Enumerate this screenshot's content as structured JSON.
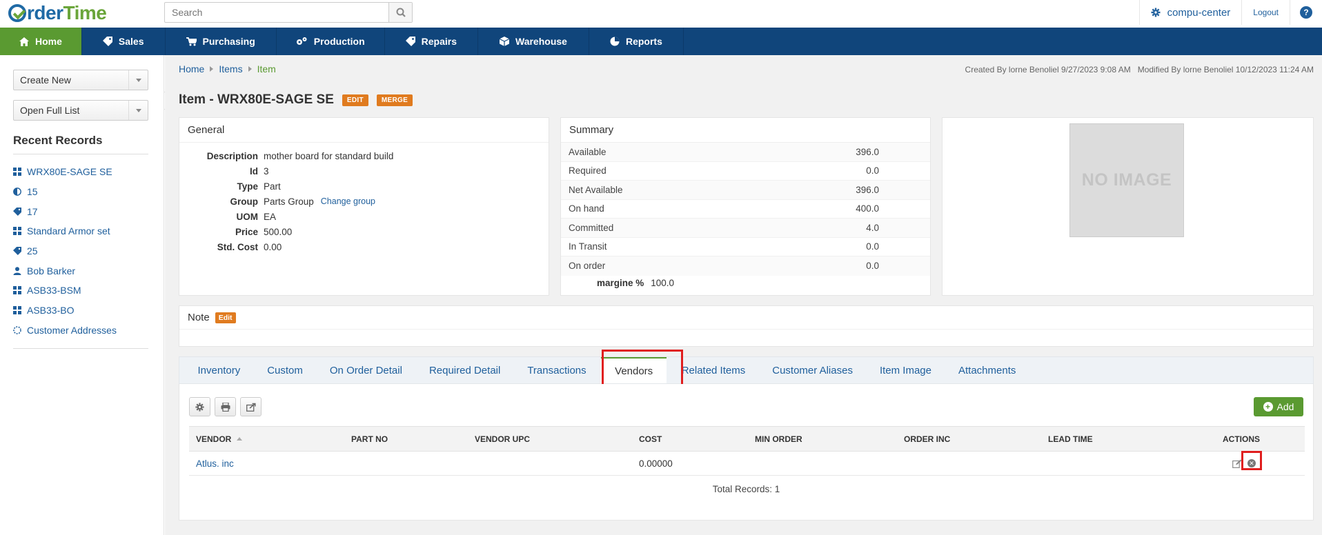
{
  "app": {
    "logo_text_1": "rder",
    "logo_text_2": "Time",
    "search_placeholder": "Search",
    "company": "compu-center",
    "logout": "Logout",
    "help": "?"
  },
  "nav": {
    "items": [
      {
        "label": "Home",
        "icon": "home-icon",
        "active": true
      },
      {
        "label": "Sales",
        "icon": "tag-icon"
      },
      {
        "label": "Purchasing",
        "icon": "cart-icon"
      },
      {
        "label": "Production",
        "icon": "gears-icon"
      },
      {
        "label": "Repairs",
        "icon": "tag-icon"
      },
      {
        "label": "Warehouse",
        "icon": "box-icon"
      },
      {
        "label": "Reports",
        "icon": "pie-chart-icon"
      }
    ]
  },
  "sidebar": {
    "create_new": "Create New",
    "open_full_list": "Open Full List",
    "recent_title": "Recent Records",
    "recent": [
      {
        "label": "WRX80E-SAGE SE",
        "icon": "grid-icon"
      },
      {
        "label": "15",
        "icon": "half-circle-icon"
      },
      {
        "label": "17",
        "icon": "tag-icon"
      },
      {
        "label": "Standard Armor set",
        "icon": "grid-icon"
      },
      {
        "label": "25",
        "icon": "tag-icon"
      },
      {
        "label": "Bob Barker",
        "icon": "user-icon"
      },
      {
        "label": "ASB33-BSM",
        "icon": "grid-icon"
      },
      {
        "label": "ASB33-BO",
        "icon": "grid-icon"
      },
      {
        "label": "Customer Addresses",
        "icon": "dotted-circle-icon"
      }
    ]
  },
  "breadcrumb": {
    "home": "Home",
    "items": "Items",
    "current": "Item"
  },
  "audit": "Created By lorne Benoliel 9/27/2023 9:08 AM   Modified By lorne Benoliel 10/12/2023 11:24 AM",
  "title": {
    "text": "Item - WRX80E-SAGE SE",
    "edit": "EDIT",
    "merge": "MERGE"
  },
  "general": {
    "title": "General",
    "rows": [
      {
        "k": "Description",
        "v": "mother board for standard build"
      },
      {
        "k": "Id",
        "v": "3"
      },
      {
        "k": "Type",
        "v": "Part"
      },
      {
        "k": "Group",
        "v": "Parts Group",
        "link": "Change group"
      },
      {
        "k": "UOM",
        "v": "EA"
      },
      {
        "k": "Price",
        "v": "500.00"
      },
      {
        "k": "Std. Cost",
        "v": "0.00"
      }
    ]
  },
  "summary": {
    "title": "Summary",
    "rows": [
      {
        "k": "Available",
        "v": "396.0"
      },
      {
        "k": "Required",
        "v": "0.0"
      },
      {
        "k": "Net Available",
        "v": "396.0"
      },
      {
        "k": "On hand",
        "v": "400.0"
      },
      {
        "k": "Committed",
        "v": "4.0"
      },
      {
        "k": "In Transit",
        "v": "0.0"
      },
      {
        "k": "On order",
        "v": "0.0"
      }
    ],
    "margin_label": "margine %",
    "margin_value": "100.0"
  },
  "image": {
    "placeholder": "NO IMAGE"
  },
  "note": {
    "title": "Note",
    "edit": "Edit"
  },
  "tabs": [
    "Inventory",
    "Custom",
    "On Order Detail",
    "Required Detail",
    "Transactions",
    "Vendors",
    "Related Items",
    "Customer Aliases",
    "Item Image",
    "Attachments"
  ],
  "active_tab": "Vendors",
  "vendors": {
    "add_label": "Add",
    "columns": [
      "VENDOR",
      "PART NO",
      "VENDOR UPC",
      "COST",
      "MIN ORDER",
      "ORDER INC",
      "LEAD TIME",
      "ACTIONS"
    ],
    "rows": [
      {
        "vendor": "Atlus. inc",
        "part_no": "",
        "vendor_upc": "",
        "cost": "0.00000",
        "min_order": "",
        "order_inc": "",
        "lead_time": ""
      }
    ],
    "total": "Total Records: 1"
  },
  "colors": {
    "nav_bg": "#10457b",
    "active_green": "#5a9a31",
    "badge_orange": "#e07b1f",
    "highlight_red": "#e01e1e",
    "link_blue": "#1f5f9c"
  }
}
